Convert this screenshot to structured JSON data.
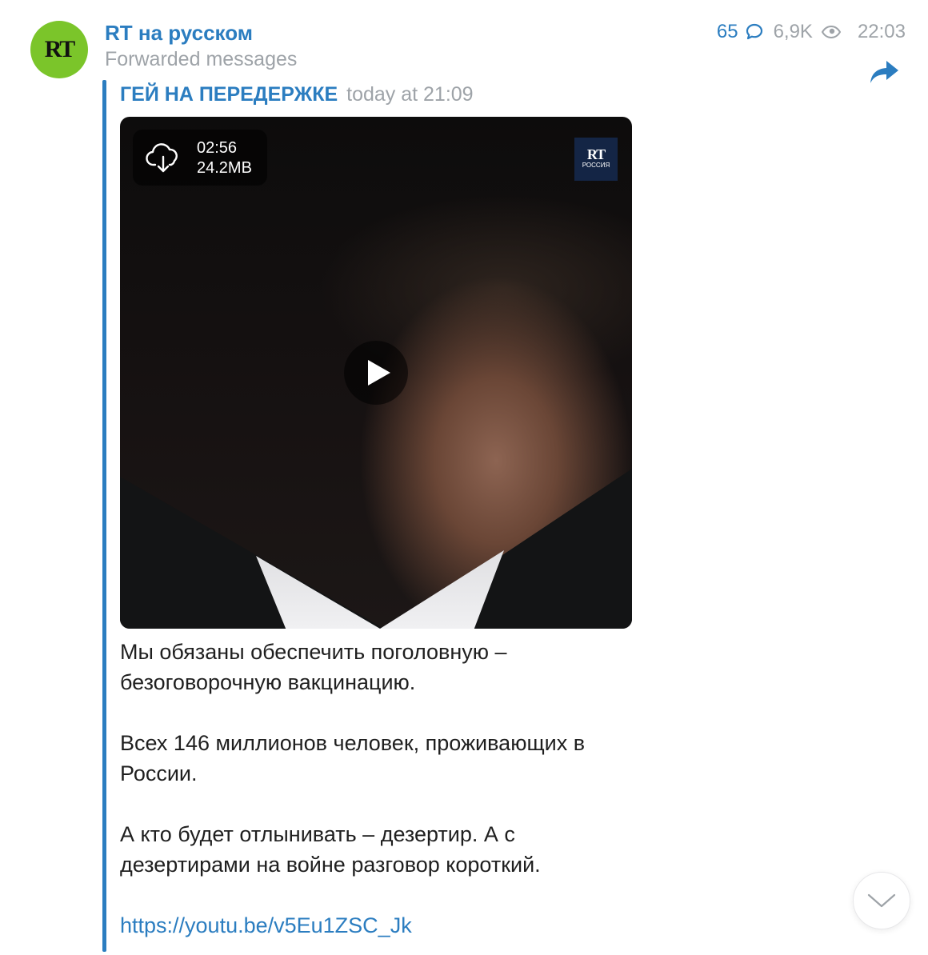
{
  "channel": {
    "avatar_text": "RT",
    "name": "RT на русском",
    "subtitle": "Forwarded messages",
    "comments": "65",
    "views": "6,9K",
    "time": "22:03"
  },
  "forward": {
    "from": "ГЕЙ НА ПЕРЕДЕРЖКЕ",
    "date": "today at 21:09"
  },
  "video": {
    "duration": "02:56",
    "size": "24.2MB",
    "badge_main": "RT",
    "badge_sub": "РОССИЯ"
  },
  "message": {
    "p1": "Мы обязаны обеспечить поголовную – безоговорочную вакцинацию.",
    "p2": "Всех 146 миллионов человек, проживающих в России.",
    "p3": "А кто будет отлынивать – дезертир. А с дезертирами на войне разговор короткий.",
    "link": "https://youtu.be/v5Eu1ZSC_Jk"
  },
  "icons": {
    "comment": "comment-bubble-icon",
    "views": "eye-icon",
    "share": "share-arrow-icon",
    "download": "cloud-download-icon",
    "play": "play-icon",
    "scroll": "chevron-down-icon"
  },
  "colors": {
    "accent": "#2b7dc0",
    "muted": "#9ea3a8",
    "avatar_bg": "#7bc52a"
  }
}
